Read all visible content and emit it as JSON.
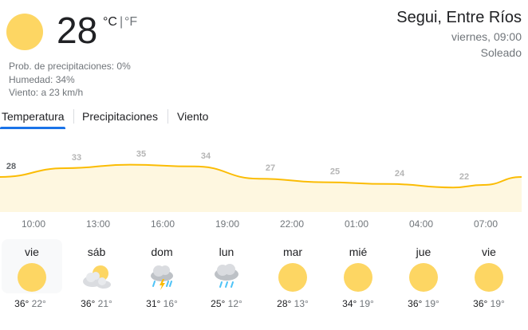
{
  "current": {
    "temp": "28",
    "unit_c": "°C",
    "unit_sep": "|",
    "unit_f": "°F",
    "icon": "sun-icon",
    "precip": "Prob. de precipitaciones: 0%",
    "humidity": "Humedad: 34%",
    "wind": "Viento: a 23 km/h"
  },
  "location": {
    "name": "Segui, Entre Ríos",
    "datetime": "viernes, 09:00",
    "condition": "Soleado"
  },
  "tabs": [
    {
      "label": "Temperatura",
      "selected": true
    },
    {
      "label": "Precipitaciones",
      "selected": false
    },
    {
      "label": "Viento",
      "selected": false
    }
  ],
  "chart_data": {
    "type": "area",
    "x": [
      "10:00",
      "13:00",
      "16:00",
      "19:00",
      "22:00",
      "01:00",
      "04:00",
      "07:00"
    ],
    "values": [
      28,
      33,
      35,
      34,
      27,
      25,
      24,
      22
    ],
    "labels": [
      "28",
      "33",
      "35",
      "34",
      "27",
      "25",
      "24",
      "22"
    ],
    "colors": {
      "line": "#fbbc04",
      "fill": "#fef7e0"
    }
  },
  "days": [
    {
      "name": "vie",
      "icon": "sun-icon",
      "hi": "36°",
      "lo": "22°",
      "selected": true
    },
    {
      "name": "sáb",
      "icon": "partly-cloudy-icon",
      "hi": "36°",
      "lo": "21°",
      "selected": false
    },
    {
      "name": "dom",
      "icon": "thunderstorm-icon",
      "hi": "31°",
      "lo": "16°",
      "selected": false
    },
    {
      "name": "lun",
      "icon": "rain-icon",
      "hi": "25°",
      "lo": "12°",
      "selected": false
    },
    {
      "name": "mar",
      "icon": "sun-icon",
      "hi": "28°",
      "lo": "13°",
      "selected": false
    },
    {
      "name": "mié",
      "icon": "sun-icon",
      "hi": "34°",
      "lo": "19°",
      "selected": false
    },
    {
      "name": "jue",
      "icon": "sun-icon",
      "hi": "36°",
      "lo": "19°",
      "selected": false
    },
    {
      "name": "vie",
      "icon": "sun-icon",
      "hi": "36°",
      "lo": "19°",
      "selected": false
    }
  ]
}
